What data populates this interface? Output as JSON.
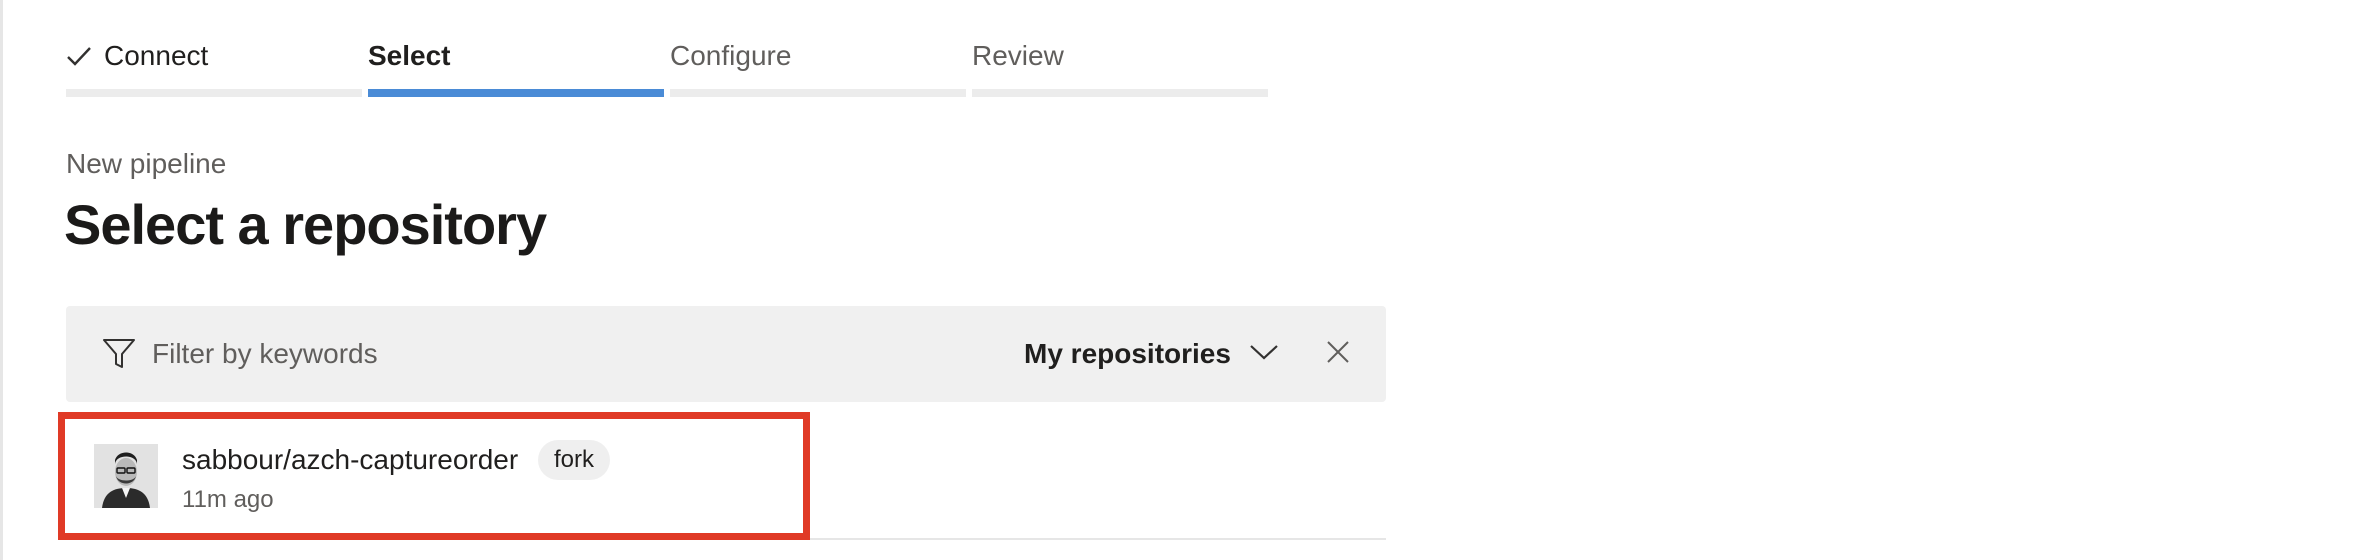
{
  "stepper": {
    "steps": [
      {
        "label": "Connect",
        "state": "done",
        "icon": "check-icon"
      },
      {
        "label": "Select",
        "state": "active"
      },
      {
        "label": "Configure",
        "state": "pending"
      },
      {
        "label": "Review",
        "state": "pending"
      }
    ],
    "active_color": "#4a8bd6"
  },
  "header": {
    "breadcrumb": "New pipeline",
    "title": "Select a repository"
  },
  "filter": {
    "icon": "filter-icon",
    "placeholder": "Filter by keywords",
    "value": "",
    "scope": "My repositories",
    "scope_icon": "chevron-down-icon",
    "clear_icon": "close-icon"
  },
  "repositories": [
    {
      "name": "sabbour/azch-captureorder",
      "badge": "fork",
      "updated": "11m ago",
      "avatar": "avatar-photo"
    }
  ],
  "highlight_color": "#e03a26"
}
